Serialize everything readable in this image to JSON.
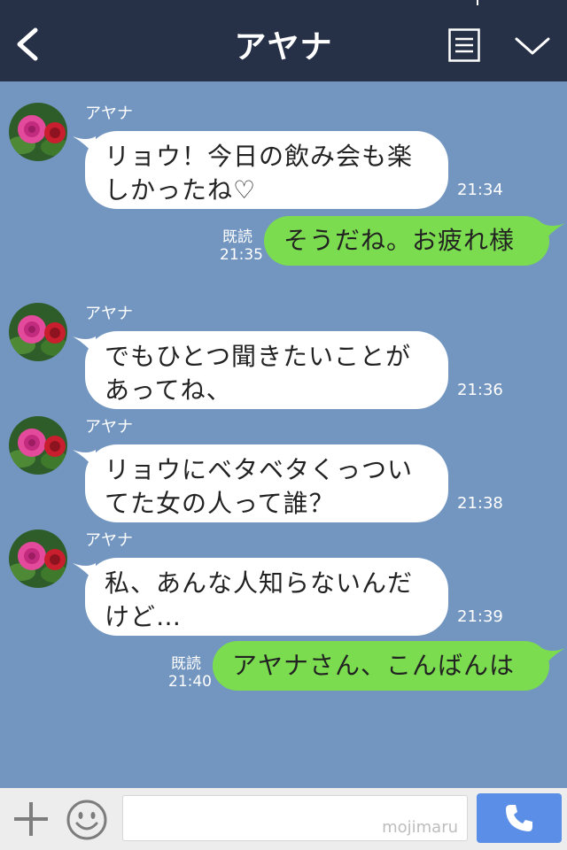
{
  "header": {
    "title": "アヤナ",
    "back_icon": "chevron-left-icon",
    "menu_icon": "list-menu-icon",
    "collapse_icon": "chevron-down-icon"
  },
  "messages": [
    {
      "direction": "in",
      "sender": "アヤナ",
      "lines": [
        "リョウ！今日の飲み会も楽",
        "しかったね♡"
      ],
      "time": "21:34"
    },
    {
      "direction": "out",
      "text": "そうだね。お疲れ様",
      "read": "既読",
      "time": "21:35"
    },
    {
      "direction": "in",
      "sender": "アヤナ",
      "lines": [
        "でもひとつ聞きたいことが",
        "あってね、"
      ],
      "time": "21:36"
    },
    {
      "direction": "in",
      "sender": "アヤナ",
      "lines": [
        "リョウにベタベタくっつい",
        "てた女の人って誰？"
      ],
      "time": "21:38"
    },
    {
      "direction": "in",
      "sender": "アヤナ",
      "lines": [
        "私、あんな人知らないんだ",
        "けど…"
      ],
      "time": "21:39"
    },
    {
      "direction": "out",
      "text": "アヤナさん、こんばんは",
      "read": "既読",
      "time": "21:40"
    }
  ],
  "footer": {
    "plus_icon": "plus-icon",
    "sticker_icon": "smiley-icon",
    "input_value": "",
    "watermark": "mojimaru",
    "send_icon": "phone-icon"
  },
  "colors": {
    "header_bg": "#263046",
    "chat_bg": "#7396c1",
    "incoming_bubble": "#ffffff",
    "outgoing_bubble": "#7bdc4f",
    "call_button": "#5b8ee6"
  }
}
